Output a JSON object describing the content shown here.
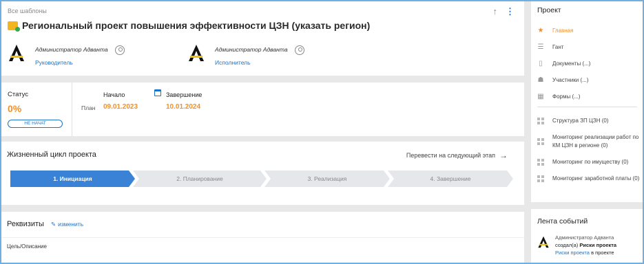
{
  "header": {
    "breadcrumb": "Все шаблоны",
    "title": "Региональный проект повышения эффективности ЦЗН (указать регион)",
    "persons": [
      {
        "name": "Администратор Адванта",
        "role": "Руководитель"
      },
      {
        "name": "Администратор Адванта",
        "role": "Исполнитель"
      }
    ]
  },
  "status": {
    "label": "Статус",
    "percent": "0%",
    "badge": "НЕ НАЧАТ",
    "plan_label": "План",
    "start_label": "Начало",
    "start_value": "09.01.2023",
    "end_label": "Завершение",
    "end_value": "10.01.2024"
  },
  "lifecycle": {
    "title": "Жизненный цикл проекта",
    "next_label": "Перевести на следующий этап",
    "steps": [
      "1. Инициация",
      "2. Планирование",
      "3. Реализация",
      "4. Завершение"
    ]
  },
  "requisites": {
    "title": "Реквизиты",
    "edit_label": "изменить",
    "field_label": "Цель/Описание"
  },
  "sidebar": {
    "title": "Проект",
    "items": [
      {
        "label": "Главная",
        "icon": "star-icon"
      },
      {
        "label": "Гант",
        "icon": "gantt-icon"
      },
      {
        "label": "Документы (...)",
        "icon": "document-icon"
      },
      {
        "label": "Участники (...)",
        "icon": "people-icon"
      },
      {
        "label": "Формы (...)",
        "icon": "form-icon"
      }
    ],
    "monitoring": [
      {
        "label": "Структура ЗП ЦЗН (0)"
      },
      {
        "label": "Мониторинг реализации работ по КМ ЦЗН в регионе (0)"
      },
      {
        "label": "Мониторинг по имуществу (0)"
      },
      {
        "label": "Мониторинг заработной платы (0)"
      }
    ]
  },
  "feed": {
    "title": "Лента событий",
    "item": {
      "who": "Администратор Адванта",
      "action": "создал(а)",
      "object": "Риски проекта",
      "link": "Риски проекта",
      "suffix": "в проекте"
    }
  },
  "colors": {
    "accent": "#1a73c8",
    "orange": "#f0912a",
    "active_step": "#3a82d5"
  }
}
